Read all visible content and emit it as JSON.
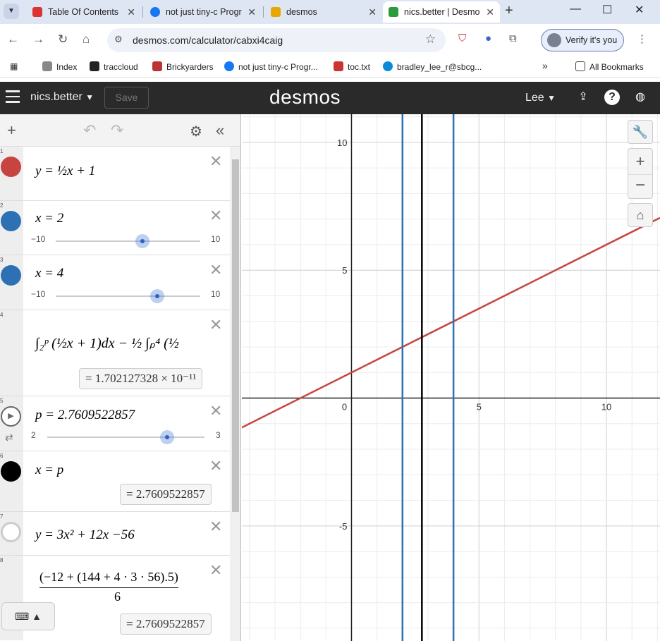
{
  "browser": {
    "tabs": [
      {
        "title": "Table Of Contents",
        "icon_color": "#d33"
      },
      {
        "title": "not just tiny-c Progr",
        "icon_color": "#1877f2"
      },
      {
        "title": "desmos",
        "icon_color": "#e6a700"
      },
      {
        "title": "nics.better | Desmo",
        "icon_color": "#2a9d3a"
      }
    ],
    "url": "desmos.com/calculator/cabxi4caig",
    "verify_label": "Verify it's you",
    "bookmarks": [
      {
        "label": "Index",
        "color": "#888"
      },
      {
        "label": "traccloud",
        "color": "#222"
      },
      {
        "label": "Brickyarders",
        "color": "#b33"
      },
      {
        "label": "not just tiny-c Progr...",
        "color": "#1877f2"
      },
      {
        "label": "toc.txt",
        "color": "#c33"
      },
      {
        "label": "bradley_lee_r@sbcg...",
        "color": "#0b8ad8"
      }
    ],
    "all_bookmarks": "All Bookmarks"
  },
  "desmos": {
    "graph_name": "nics.better",
    "save_label": "Save",
    "logo": "desmos",
    "user": "Lee"
  },
  "expressions": [
    {
      "num": "1",
      "color": "#c74440",
      "latex_text": "y = ½x + 1"
    },
    {
      "num": "2",
      "color": "#2d70b3",
      "latex_text": "x = 2",
      "slider": {
        "min": "−10",
        "max": "10",
        "value": 2
      }
    },
    {
      "num": "3",
      "color": "#2d70b3",
      "latex_text": "x = 4",
      "slider": {
        "min": "−10",
        "max": "10",
        "value": 4
      }
    },
    {
      "num": "4",
      "latex_text": "∫₂ᵖ (½x + 1)dx − ½ ∫ₚ⁴ (½",
      "result": "= 1.702127328 × 10⁻¹¹"
    },
    {
      "num": "5",
      "latex_text": "p = 2.7609522857",
      "slider": {
        "min": "2",
        "max": "3",
        "value": 2.7609522857
      }
    },
    {
      "num": "6",
      "color": "#000000",
      "latex_text": "x = p",
      "result": "= 2.7609522857"
    },
    {
      "num": "7",
      "latex_text": "y = 3x² + 12x −56"
    },
    {
      "num": "8",
      "latex_text": "(−12 + (144 + 4 · 3 · 56).5)",
      "denominator": "6",
      "result": "= 2.7609522857"
    }
  ],
  "chart_data": {
    "type": "line",
    "x_range": [
      -4.3,
      12.1
    ],
    "y_range": [
      -9.5,
      11.1
    ],
    "x_ticks": [
      "0",
      "5",
      "10"
    ],
    "y_ticks": [
      "10",
      "5",
      "-5"
    ],
    "grid": true,
    "series": [
      {
        "kind": "line",
        "equation": "y = 0.5x + 1",
        "color": "#c74440"
      },
      {
        "kind": "vertical",
        "x": 2,
        "color": "#2d70b3"
      },
      {
        "kind": "vertical",
        "x": 4,
        "color": "#2d70b3"
      },
      {
        "kind": "vertical",
        "x": 2.7609522857,
        "color": "#000000"
      }
    ]
  }
}
